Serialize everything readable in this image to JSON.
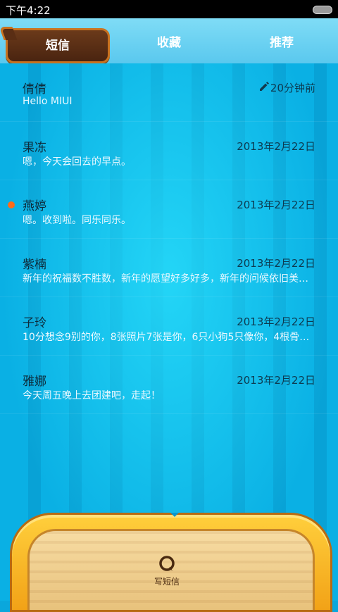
{
  "status_bar": {
    "time": "下午4:22"
  },
  "tabs": [
    {
      "label": "短信",
      "active": true
    },
    {
      "label": "收藏",
      "active": false
    },
    {
      "label": "推荐",
      "active": false
    }
  ],
  "messages": [
    {
      "name": "倩倩",
      "preview": "Hello MIUI",
      "date": "20分钟前",
      "draft": true,
      "unread": false
    },
    {
      "name": "果冻",
      "preview": "嗯，今天会回去的早点。",
      "date": "2013年2月22日",
      "draft": false,
      "unread": false
    },
    {
      "name": "燕婷",
      "preview": "嗯。收到啦。同乐同乐。",
      "date": "2013年2月22日",
      "draft": false,
      "unread": true
    },
    {
      "name": "紫楠",
      "preview": "新年的祝福数不胜数，新年的愿望好多好多，新年的问候依旧美好…",
      "date": "2013年2月22日",
      "draft": false,
      "unread": false
    },
    {
      "name": "子玲",
      "preview": "10分想念9别的你，8张照片7张是你，6只小狗5只像你，4根骨头…",
      "date": "2013年2月22日",
      "draft": false,
      "unread": false
    },
    {
      "name": "雅娜",
      "preview": "今天周五晚上去团建吧，走起！",
      "date": "2013年2月22日",
      "draft": false,
      "unread": false
    }
  ],
  "compose": {
    "label": "写短信",
    "icon": "compose-message-icon"
  },
  "colors": {
    "accent_dot": "#ff6b1a",
    "tab_active": "#4a2410",
    "background": "#0aa7dc"
  }
}
